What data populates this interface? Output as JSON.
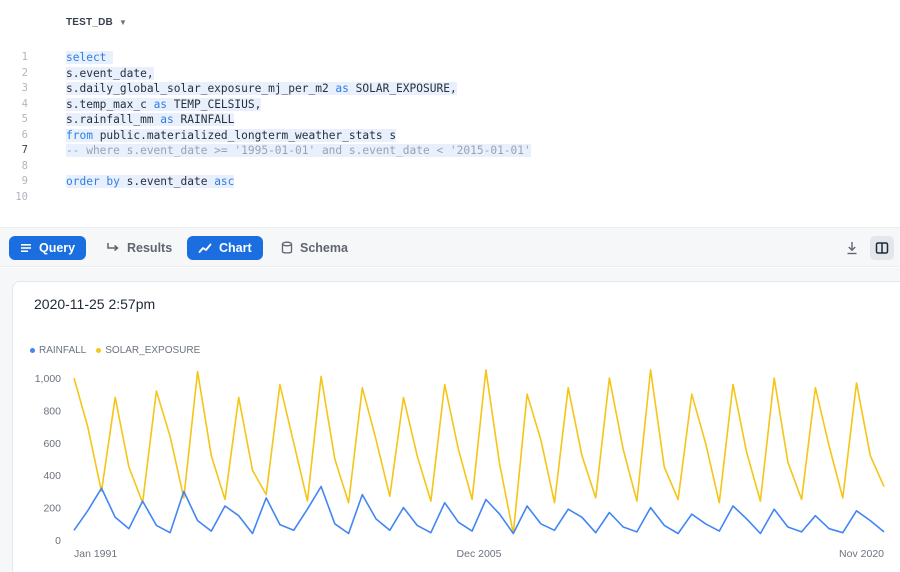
{
  "editor": {
    "database": "TEST_DB",
    "active_line": 7,
    "lines": [
      {
        "n": "1",
        "segments": [
          {
            "t": "select ",
            "c": "kw"
          }
        ]
      },
      {
        "n": "2",
        "segments": [
          {
            "t": "s.event_date,",
            "c": "tx"
          }
        ]
      },
      {
        "n": "3",
        "segments": [
          {
            "t": "s.daily_global_solar_exposure_mj_per_m2 ",
            "c": "tx"
          },
          {
            "t": "as",
            "c": "kw"
          },
          {
            "t": " SOLAR_EXPOSURE,",
            "c": "tx"
          }
        ]
      },
      {
        "n": "4",
        "segments": [
          {
            "t": "s.temp_max_c ",
            "c": "tx"
          },
          {
            "t": "as",
            "c": "kw"
          },
          {
            "t": " TEMP_CELSIUS,",
            "c": "tx"
          }
        ]
      },
      {
        "n": "5",
        "segments": [
          {
            "t": "s.rainfall_mm ",
            "c": "tx"
          },
          {
            "t": "as",
            "c": "kw"
          },
          {
            "t": " RAINFALL",
            "c": "tx"
          }
        ]
      },
      {
        "n": "6",
        "segments": [
          {
            "t": "from",
            "c": "kw"
          },
          {
            "t": " public.materialized_longterm_weather_stats s",
            "c": "tx"
          }
        ]
      },
      {
        "n": "7",
        "segments": [
          {
            "t": "-- where s.event_date >= '1995-01-01' and s.event_date < '2015-01-01'",
            "c": "cm"
          }
        ]
      },
      {
        "n": "8",
        "segments": []
      },
      {
        "n": "9",
        "segments": [
          {
            "t": "order by",
            "c": "kw"
          },
          {
            "t": " s.event_date ",
            "c": "tx"
          },
          {
            "t": "asc",
            "c": "kw"
          }
        ]
      },
      {
        "n": "10",
        "segments": []
      }
    ]
  },
  "toolbar": {
    "query_label": "Query",
    "results_label": "Results",
    "chart_label": "Chart",
    "schema_label": "Schema",
    "accent": "#1a6ee0"
  },
  "chart": {
    "title": "2020-11-25 2:57pm"
  },
  "chart_data": {
    "type": "line",
    "x_labels": [
      "Jan 1991",
      "Dec 2005",
      "Nov 2020"
    ],
    "x_range": [
      "Jan 1991",
      "Nov 2020"
    ],
    "ylim": [
      0,
      1000
    ],
    "yticks": [
      "0",
      "200",
      "400",
      "600",
      "800",
      "1,000"
    ],
    "grid": false,
    "legend_position": "top-left",
    "series": [
      {
        "name": "RAINFALL",
        "color": "#4285f4",
        "period_months": 12,
        "values": [
          60,
          180,
          320,
          140,
          70,
          240,
          90,
          45,
          300,
          120,
          55,
          210,
          150,
          40,
          260,
          95,
          60,
          190,
          330,
          100,
          40,
          280,
          130,
          60,
          200,
          90,
          45,
          230,
          110,
          55,
          250,
          160,
          40,
          210,
          100,
          60,
          190,
          140,
          45,
          170,
          80,
          50,
          200,
          90,
          40,
          160,
          100,
          55,
          210,
          130,
          40,
          190,
          80,
          50,
          150,
          70,
          45,
          180,
          120,
          50
        ]
      },
      {
        "name": "SOLAR_EXPOSURE",
        "color": "#f5c518",
        "period_months": 12,
        "values": [
          1000,
          700,
          300,
          880,
          450,
          230,
          920,
          640,
          260,
          1040,
          520,
          250,
          880,
          430,
          280,
          960,
          600,
          240,
          1010,
          500,
          230,
          940,
          620,
          270,
          880,
          520,
          240,
          960,
          560,
          250,
          1050,
          470,
          40,
          900,
          620,
          230,
          940,
          520,
          260,
          1000,
          560,
          240,
          1050,
          450,
          250,
          900,
          600,
          230,
          960,
          540,
          240,
          1000,
          480,
          250,
          940,
          580,
          260,
          970,
          520,
          330
        ]
      }
    ]
  }
}
